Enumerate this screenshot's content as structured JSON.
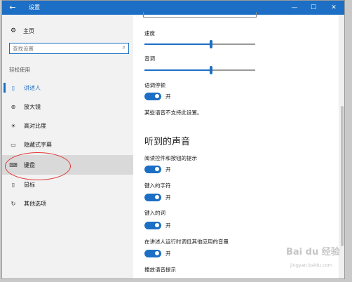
{
  "window": {
    "title": "设置",
    "back_glyph": "←",
    "min_glyph": "—",
    "max_glyph": "☐",
    "close_glyph": "✕"
  },
  "sidebar": {
    "home": {
      "label": "主页",
      "icon": "gear-icon"
    },
    "search": {
      "placeholder": "查找设置"
    },
    "section_label": "轻松使用",
    "items": [
      {
        "label": "讲述人",
        "icon": "narrator-icon",
        "active": true
      },
      {
        "label": "放大镜",
        "icon": "magnifier-icon"
      },
      {
        "label": "高对比度",
        "icon": "contrast-icon"
      },
      {
        "label": "隐藏式字幕",
        "icon": "captions-icon"
      },
      {
        "label": "键盘",
        "icon": "keyboard-icon",
        "highlighted": true
      },
      {
        "label": "鼠标",
        "icon": "mouse-icon"
      },
      {
        "label": "其他选项",
        "icon": "other-options-icon"
      }
    ]
  },
  "content": {
    "speed": {
      "label": "速度",
      "value_percent": 60
    },
    "pitch": {
      "label": "音调",
      "value_percent": 60
    },
    "intonation_pause": {
      "label": "语调停顿",
      "state": "开"
    },
    "unsupported_note": "某些语音不支持此设置。",
    "sounds_heading": "听到的声音",
    "toggles": [
      {
        "label": "阅读控件和按钮的提示",
        "state": "开"
      },
      {
        "label": "键入的字符",
        "state": "开"
      },
      {
        "label": "键入的词",
        "state": "开"
      },
      {
        "label": "在讲述人运行时调低其他应用的音量",
        "state": "开"
      }
    ],
    "last_label": "播放语音提示"
  },
  "watermark": {
    "brand": "Bai du 经验",
    "url": "jingyan.baidu.com"
  },
  "colors": {
    "accent": "#1c6fc4",
    "highlight_ring": "#e03a3a"
  }
}
